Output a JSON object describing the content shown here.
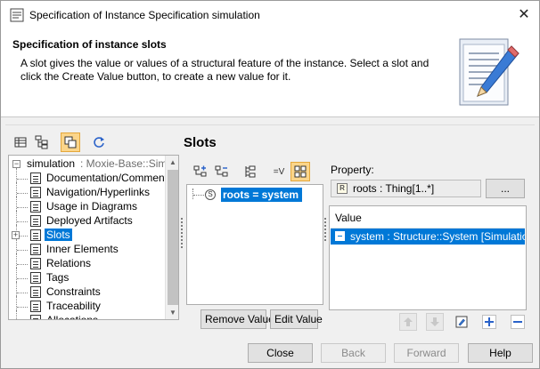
{
  "window": {
    "title": "Specification of Instance Specification simulation",
    "close_glyph": "✕"
  },
  "header": {
    "title": "Specification of instance slots",
    "description": "A slot gives the value or values of a structural feature of the instance. Select a slot and click the Create Value button, to create a new value for it.",
    "icon": "document-pencil-icon"
  },
  "left_toolbar": {
    "icons": [
      "table-view-icon",
      "tree-view-icon",
      "copy-view-icon",
      "refresh-icon"
    ]
  },
  "tree": {
    "root": {
      "label": "simulation",
      "qualifier": " : Moxie-Base::Simula"
    },
    "items": [
      {
        "label": "Documentation/Comments",
        "selected": false
      },
      {
        "label": "Navigation/Hyperlinks",
        "selected": false
      },
      {
        "label": "Usage in Diagrams",
        "selected": false
      },
      {
        "label": "Deployed Artifacts",
        "selected": false
      },
      {
        "label": "Slots",
        "selected": true
      },
      {
        "label": "Inner Elements",
        "selected": false
      },
      {
        "label": "Relations",
        "selected": false
      },
      {
        "label": "Tags",
        "selected": false
      },
      {
        "label": "Constraints",
        "selected": false
      },
      {
        "label": "Traceability",
        "selected": false
      },
      {
        "label": "Allocations",
        "selected": false
      }
    ]
  },
  "slots": {
    "title": "Slots",
    "toolbar_icons": [
      "expand-all-icon",
      "collapse-all-icon",
      "hierarchy-icon",
      "filter-value-icon",
      "grid-view-icon"
    ],
    "selected_slot": "roots = system",
    "remove_value_label": "Remove Value",
    "edit_value_label": "Edit Value"
  },
  "property": {
    "label": "Property:",
    "value": "roots : Thing[1..*]",
    "badge": "R",
    "browse_label": "..."
  },
  "value_table": {
    "header": "Value",
    "rows": [
      "system : Structure::System [Simulation]"
    ]
  },
  "value_actions": [
    "move-up-icon",
    "move-down-icon",
    "edit-icon",
    "add-icon",
    "remove-icon"
  ],
  "footer": {
    "close": "Close",
    "back": "Back",
    "forward": "Forward",
    "help": "Help"
  }
}
